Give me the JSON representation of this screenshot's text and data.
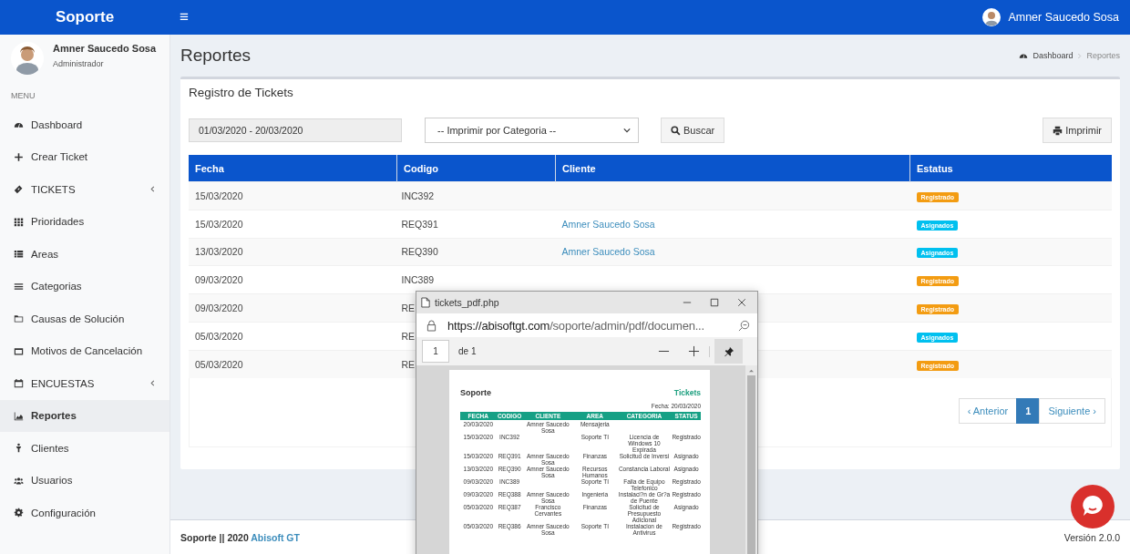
{
  "topbar": {
    "brand": "Soporte",
    "menu_glyph": "≡",
    "user": "Amner Saucedo Sosa"
  },
  "sidebar": {
    "user": {
      "name": "Amner Saucedo Sosa",
      "role": "Administrador"
    },
    "menu_label": "MENU",
    "items": [
      {
        "label": "Dashboard",
        "selected": false
      },
      {
        "label": "Crear Ticket",
        "selected": false
      },
      {
        "label": "TICKETS",
        "selected": false,
        "kind": "group",
        "expanded": false
      },
      {
        "label": "Prioridades",
        "selected": false
      },
      {
        "label": "Areas",
        "selected": false
      },
      {
        "label": "Categorias",
        "selected": false
      },
      {
        "label": "Causas de Solución",
        "selected": false
      },
      {
        "label": "Motivos de Cancelación",
        "selected": false
      },
      {
        "label": "ENCUESTAS",
        "selected": false,
        "kind": "group",
        "expanded": false
      },
      {
        "label": "Reportes",
        "selected": true
      },
      {
        "label": "Clientes",
        "selected": false
      },
      {
        "label": "Usuarios",
        "selected": false
      },
      {
        "label": "Configuración",
        "selected": false
      }
    ]
  },
  "page": {
    "title": "Reportes",
    "breadcrumb": [
      "Dashboard",
      "Reportes"
    ]
  },
  "box": {
    "title": "Registro de Tickets",
    "date_range": "01/03/2020 - 20/03/2020",
    "category_select": "-- Imprimir por Categoria --",
    "search_button": "Buscar",
    "print_button": "Imprimir"
  },
  "table": {
    "columns": [
      "Fecha",
      "Codigo",
      "Cliente",
      "Estatus"
    ],
    "rows": [
      {
        "fecha": "15/03/2020",
        "codigo": "INC392",
        "status": {
          "text": "Registrado",
          "color": "#f39c12"
        }
      },
      {
        "fecha": "15/03/2020",
        "codigo": "REQ391",
        "cliente": "Amner Saucedo Sosa",
        "status": {
          "text": "Asignados",
          "color": "#00c0ef"
        }
      },
      {
        "fecha": "13/03/2020",
        "codigo": "REQ390",
        "cliente": "Amner Saucedo Sosa",
        "status": {
          "text": "Asignados",
          "color": "#00c0ef"
        }
      },
      {
        "fecha": "09/03/2020",
        "codigo": "INC389",
        "status": {
          "text": "Registrado",
          "color": "#f39c12"
        }
      },
      {
        "fecha": "09/03/2020",
        "codigo": "RE",
        "status": {
          "text": "Registrado",
          "color": "#f39c12"
        }
      },
      {
        "fecha": "05/03/2020",
        "codigo": "RE",
        "status": {
          "text": "Asignados",
          "color": "#00c0ef"
        }
      },
      {
        "fecha": "05/03/2020",
        "codigo": "RE",
        "status": {
          "text": "Registrado",
          "color": "#f39c12"
        }
      }
    ]
  },
  "pagination": [
    {
      "label": "‹ Anterior",
      "selected": false
    },
    {
      "label": "1",
      "selected": true
    },
    {
      "label": "Siguiente ›",
      "selected": false
    }
  ],
  "footer": {
    "brand": "Soporte || 2020",
    "link": "Abisoft GT",
    "version": "Versión 2.0.0"
  },
  "popup": {
    "title": "tickets_pdf.php",
    "url_host": "https://abisoftgt.com",
    "url_path": "/soporte/admin/pdf/documen...",
    "page_number": "1",
    "page_count": "de 1",
    "document": {
      "title": "Soporte",
      "heading": "Tickets",
      "date": "Fecha: 20/03/2020",
      "columns": [
        "FECHA",
        "CODIGO",
        "CLIENTE",
        "AREA",
        "CATEGORIA",
        "STATUS"
      ],
      "rows": [
        [
          "20/03/2020",
          "",
          "Amner Saucedo Sosa",
          "Mensajeria",
          "",
          ""
        ],
        [
          "15/03/2020",
          "INC392",
          "",
          "Soporte TI",
          "Licencia de Windows 10 Expirada",
          "Registrado"
        ],
        [
          "15/03/2020",
          "REQ391",
          "Amner Saucedo Sosa",
          "Finanzas",
          "Solicitud de Inversi",
          "Asignado"
        ],
        [
          "13/03/2020",
          "REQ390",
          "Amner Saucedo Sosa",
          "Recursos Humanos",
          "Constancia Laboral",
          "Asignado"
        ],
        [
          "09/03/2020",
          "INC389",
          "",
          "Soporte TI",
          "Falla de Equipo Telefonico",
          "Registrado"
        ],
        [
          "09/03/2020",
          "REQ388",
          "Amner Saucedo Sosa",
          "Ingenieria",
          "Instalaci?n de Gr?a de Puente",
          "Registrado"
        ],
        [
          "05/03/2020",
          "REQ387",
          "Francisco Cervantes",
          "Finanzas",
          "Solicitud de Presupuesto Adicional",
          "Asignado"
        ],
        [
          "05/03/2020",
          "REQ386",
          "Amner Saucedo Sosa",
          "Soporte TI",
          "Instalacion de Antivirus",
          "Registrado"
        ]
      ]
    }
  }
}
